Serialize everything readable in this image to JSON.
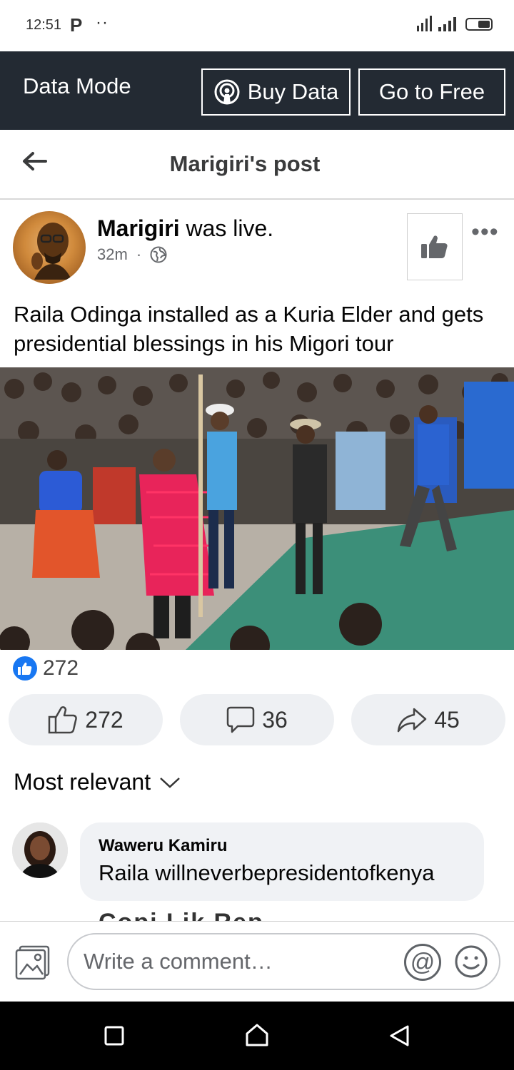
{
  "status_bar": {
    "time": "12:51",
    "app_glyph": "P",
    "dots": "··",
    "icons": [
      "network-activity-icon",
      "signal-icon",
      "signal-icon",
      "battery-icon"
    ]
  },
  "data_bar": {
    "mode_label": "Data Mode",
    "buy_data_label": "Buy Data",
    "go_free_label": "Go to Free",
    "background": "#232a33"
  },
  "header": {
    "title": "Marigiri's post"
  },
  "post": {
    "author": "Marigiri",
    "action": " was live.",
    "time": "32m",
    "separator": "·",
    "privacy_icon": "globe-icon",
    "more_label": "•••",
    "caption": "Raila Odinga installed as a Kuria Elder and gets presidential blessings in his Migori tour"
  },
  "reactions": {
    "count": "272",
    "like_color": "#1877f2"
  },
  "actions": {
    "like_count": "272",
    "comment_count": "36",
    "share_count": "45"
  },
  "comments": {
    "sort_label": "Most relevant",
    "items": [
      {
        "author": "Waweru Kamiru",
        "text": "Raila willneverbepresidentofkenya"
      }
    ],
    "partial_next": "Copi Lik Rep"
  },
  "composer": {
    "placeholder": "Write a comment…",
    "at_symbol": "@"
  }
}
